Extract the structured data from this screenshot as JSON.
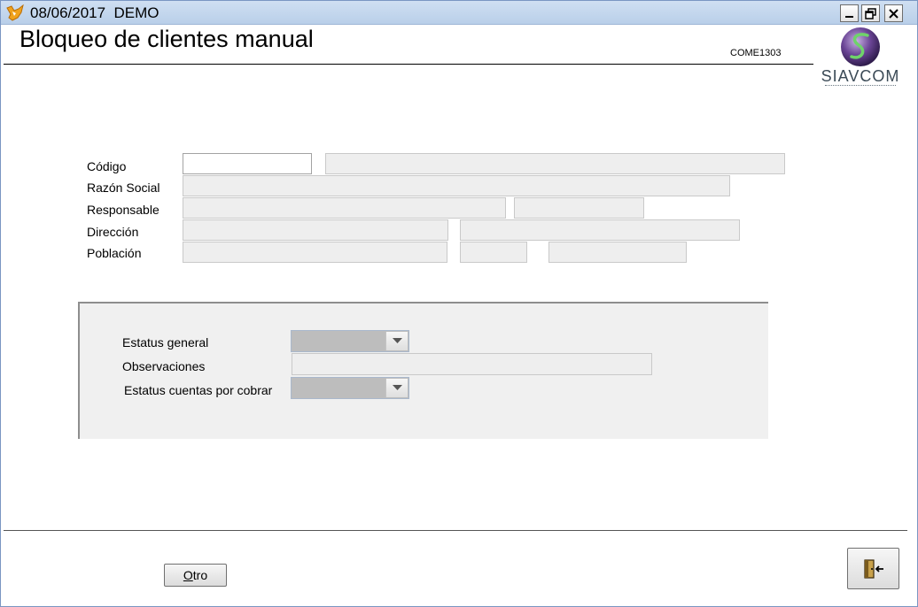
{
  "window": {
    "title": "08/06/2017  DEMO",
    "minimize_label": "_",
    "restore_label": "restore",
    "close_label": "X"
  },
  "header": {
    "title": "Bloqueo de clientes manual",
    "form_code": "COME1303",
    "logo_text": "SIAVCOM"
  },
  "customer": {
    "codigo_label": "Código",
    "razon_social_label": "Razón Social",
    "responsable_label": "Responsable",
    "direccion_label": "Dirección",
    "poblacion_label": "Población"
  },
  "status_panel": {
    "estatus_general_label": "Estatus general",
    "observaciones_label": "Observaciones",
    "estatus_cxc_label": "Estatus cuentas por cobrar"
  },
  "footer": {
    "otro_label_underlined": "O",
    "otro_label_rest": "tro"
  },
  "icons": {
    "app": "fox-icon",
    "exit": "exit-door-icon",
    "dropdown": "chevron-down-icon"
  },
  "colors": {
    "titlebar": "#c4d7ef",
    "readonly_field": "#eeeeee",
    "panel": "#f0f0f0",
    "combo": "#bdbdbd"
  }
}
